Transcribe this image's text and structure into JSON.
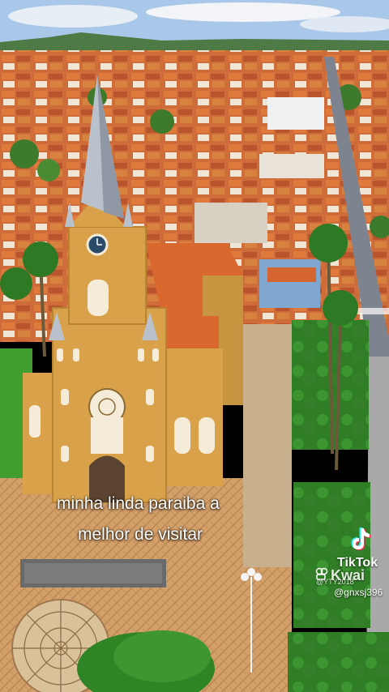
{
  "caption": {
    "line1": "minha linda paraiba a",
    "line2": "melhor de visitar"
  },
  "watermark": {
    "brand": "TikTok",
    "secondary_brand": "Kwai",
    "secondary_handle": "@YTY2018",
    "handle": "@gnxsj396",
    "logo_icon": "tiktok-note-icon",
    "kwai_icon": "kwai-camera-icon"
  },
  "colors": {
    "church_wall": "#d9a24a",
    "church_roof": "#d9682f",
    "lawn": "#3f9e2e",
    "sky": "#a9c7e8"
  }
}
